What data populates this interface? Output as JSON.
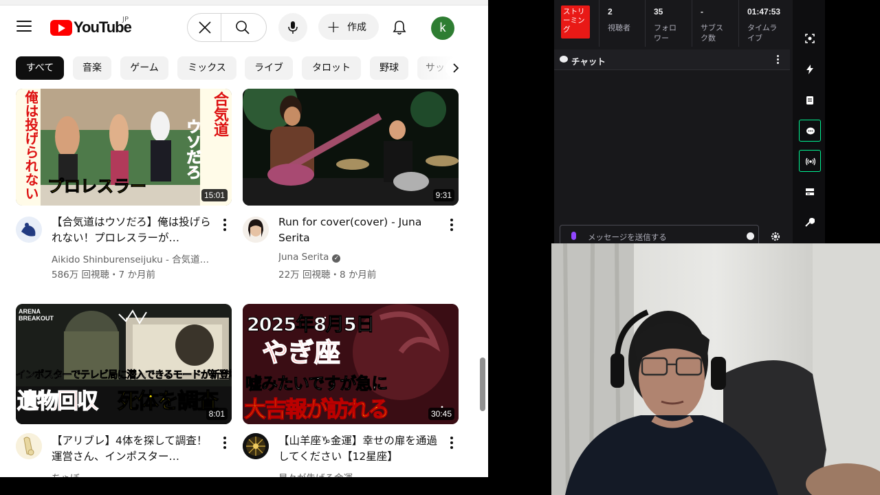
{
  "youtube": {
    "logo_text": "YouTube",
    "region": "JP",
    "create_label": "作成",
    "avatar_letter": "k",
    "chips": [
      "すべて",
      "音楽",
      "ゲーム",
      "ミックス",
      "ライブ",
      "タロット",
      "野球",
      "サッ"
    ],
    "videos": [
      {
        "title": "【合気道はウソだろ】俺は投げられない！プロレスラーが…",
        "channel": "Aikido Shinburenseijuku - 合気道…",
        "meta": "586万 回視聴・7 か月前",
        "duration": "15:01",
        "thumb_text": [
          "俺は投げられない",
          "合気道",
          "ウソだろ",
          "プロレスラー"
        ]
      },
      {
        "title": "Run for cover(cover) - Juna Serita",
        "channel": "Juna Serita",
        "meta": "22万 回視聴・8 か月前",
        "duration": "9:31"
      },
      {
        "title": "【アリブレ】4体を探して調査！運営さん、インポスター…",
        "channel": "ちゃぼ",
        "meta": "",
        "duration": "8:01",
        "thumb_text": [
          "ARENA BREAKOUT",
          "インポスターでテレビ局に潜入できるモードが新登場ww",
          "遺物回収",
          "死体を調査"
        ]
      },
      {
        "title": "【山羊座♑金運】幸せの扉を通過してください【12星座】",
        "channel": "星々が告げる金運",
        "meta": "",
        "duration": "30:45",
        "thumb_text": [
          "2025年8月5日",
          "やぎ座",
          "嘘みたいですが急に",
          "大吉報が訪れる"
        ]
      }
    ]
  },
  "dashboard": {
    "stream_badge": "ストリーミング",
    "stats": [
      {
        "value": "2",
        "label": "視聴者"
      },
      {
        "value": "35",
        "label": "フォロワー"
      },
      {
        "value": "-",
        "label": "サブスク数"
      },
      {
        "value": "01:47:53",
        "label": "タイムライブ"
      }
    ],
    "chat_title": "チャット",
    "chat_placeholder": "メッセージを送信する",
    "accent": "#00f593",
    "badge_color": "#e91916"
  },
  "icons": [
    "menu-icon",
    "close-icon",
    "search-icon",
    "mic-icon",
    "plus-icon",
    "bell-icon",
    "chevron-right-icon",
    "more-vert-icon",
    "verified-icon",
    "camera-focus-icon",
    "bolt-icon",
    "notes-icon",
    "chat-icon",
    "broadcast-icon",
    "layout-icon",
    "wrench-icon",
    "gear-icon"
  ]
}
